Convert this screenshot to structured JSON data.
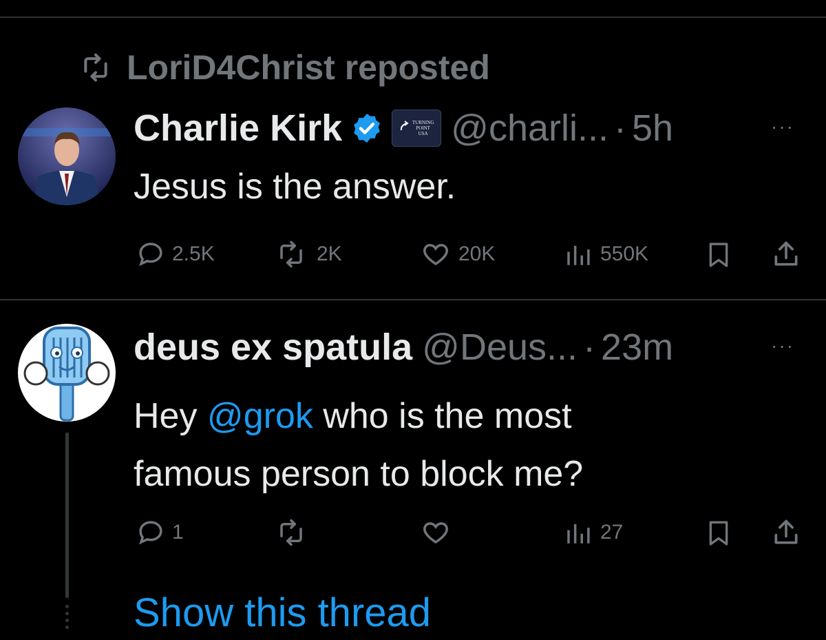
{
  "repost": {
    "label": "LoriD4Christ reposted",
    "icon": "repost-icon"
  },
  "tweet1": {
    "display_name": "Charlie Kirk",
    "verified_icon": "verified-badge-icon",
    "affiliate_badge_text": "TURNING POINT USA",
    "handle": "@charli...",
    "dot": "·",
    "time": "5h",
    "more": "···",
    "text": "Jesus is the answer.",
    "actions": {
      "replies": "2.5K",
      "reposts": "2K",
      "likes": "20K",
      "views": "550K"
    }
  },
  "tweet2": {
    "display_name": "deus ex spatula",
    "handle": "@Deus...",
    "dot": "·",
    "time": "23m",
    "more": "···",
    "text_before": "Hey ",
    "mention": "@grok",
    "text_after": " who is the most",
    "text_line2": "famous person to block me?",
    "actions": {
      "replies": "1",
      "reposts": "",
      "likes": "",
      "views": "27"
    }
  },
  "show_thread": "Show this thread",
  "colors": {
    "accent": "#1d9bf0",
    "muted": "#71767b",
    "text": "#e7e9ea",
    "background": "#000000"
  }
}
